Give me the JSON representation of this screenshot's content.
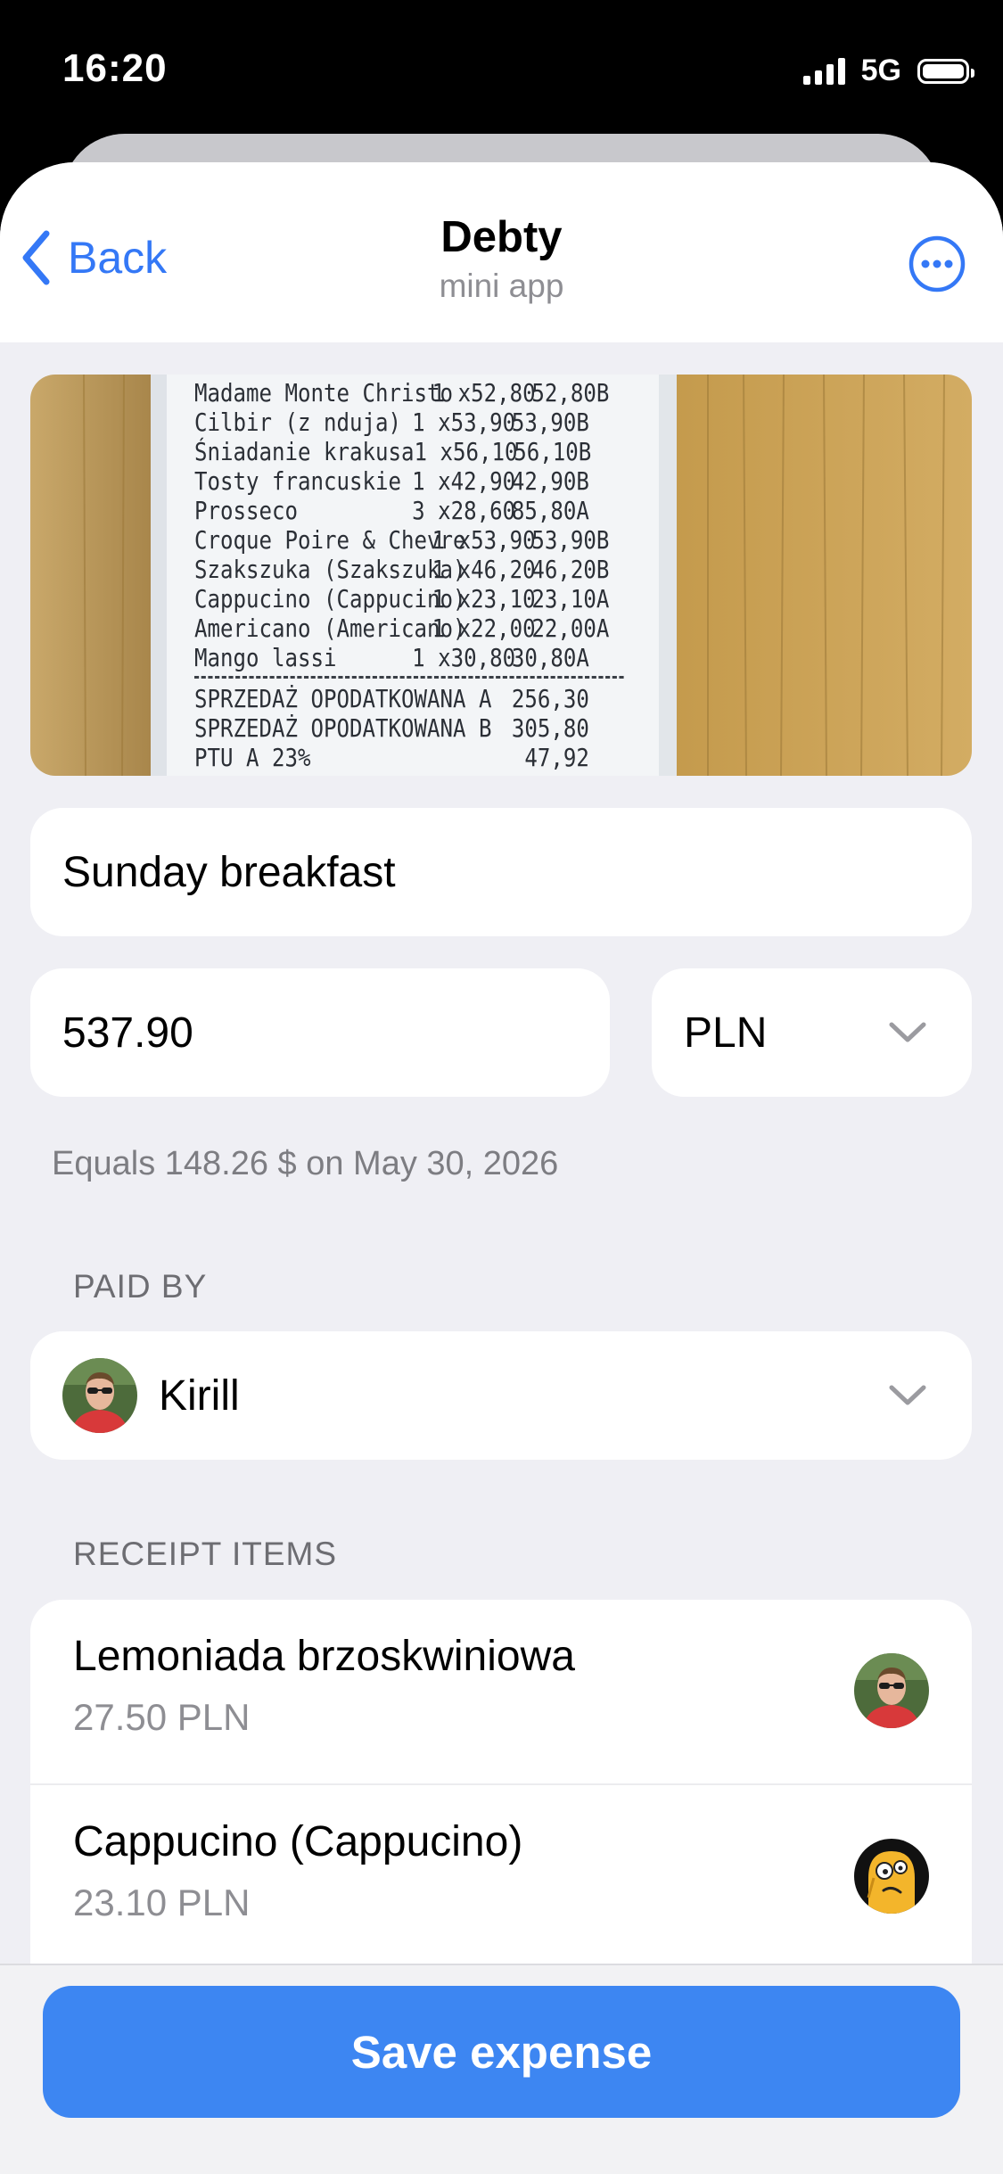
{
  "status_bar": {
    "time": "16:20",
    "network": "5G",
    "signal_icon": "cellular-signal-icon",
    "battery_icon": "battery-icon"
  },
  "nav": {
    "back_label": "Back",
    "title": "Debty",
    "subtitle": "mini app",
    "more_icon": "ellipsis-circle-icon"
  },
  "receipt_image": {
    "lines": [
      {
        "name": "Madame Monte Christo",
        "qty": "1 x52,80",
        "total": "52,80B"
      },
      {
        "name": "Cilbir (z nduja)",
        "qty": "1 x53,90",
        "total": "53,90B"
      },
      {
        "name": "Śniadanie krakusa",
        "qty": "1 x56,10",
        "total": "56,10B"
      },
      {
        "name": "Tosty francuskie",
        "qty": "1 x42,90",
        "total": "42,90B"
      },
      {
        "name": "Prosseco",
        "qty": "3 x28,60",
        "total": "85,80A"
      },
      {
        "name": "Croque Poire & Chevre",
        "qty": "1 x53,90",
        "total": "53,90B"
      },
      {
        "name": "Szakszuka (Szakszuka)",
        "qty": "1 x46,20",
        "total": "46,20B"
      },
      {
        "name": "Cappucino (Cappucino)",
        "qty": "1 x23,10",
        "total": "23,10A"
      },
      {
        "name": "Americano (Americano)",
        "qty": "1 x22,00",
        "total": "22,00A"
      },
      {
        "name": "Mango lassi",
        "qty": "1 x30,80",
        "total": "30,80A"
      }
    ],
    "summary": [
      {
        "name": "SPRZEDAŻ OPODATKOWANA A",
        "total": "256,30"
      },
      {
        "name": "SPRZEDAŻ OPODATKOWANA B",
        "total": "305,80"
      },
      {
        "name": "PTU A 23%",
        "total": "47,92"
      }
    ]
  },
  "form": {
    "title_value": "Sunday breakfast",
    "amount_value": "537.90",
    "currency_value": "PLN",
    "conversion_note": "Equals 148.26 $ on May 30, 2026"
  },
  "paid_by": {
    "section_label": "PAID BY",
    "name": "Kirill"
  },
  "receipt_items": {
    "section_label": "RECEIPT ITEMS",
    "items": [
      {
        "name": "Lemoniada brzoskwiniowa",
        "price": "27.50 PLN",
        "avatar": "person-avatar"
      },
      {
        "name": "Cappucino (Cappucino)",
        "price": "23.10 PLN",
        "avatar": "cartoon-avatar"
      }
    ]
  },
  "footer": {
    "save_label": "Save expense"
  },
  "colors": {
    "accent": "#3d86f2",
    "link": "#3478f6",
    "background": "#efeff4"
  }
}
